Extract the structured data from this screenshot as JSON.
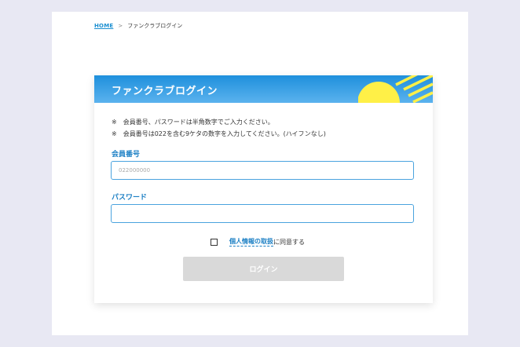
{
  "breadcrumb": {
    "home": "HOME",
    "separator": ">",
    "current": "ファンクラブログイン"
  },
  "card": {
    "title": "ファンクラブログイン"
  },
  "notes": [
    {
      "mark": "※",
      "text": "会員番号、パスワードは半角数字でご入力ください。"
    },
    {
      "mark": "※",
      "text": "会員番号は022を含む9ケタの数字を入力してください。(ハイフンなし)"
    }
  ],
  "member_number": {
    "label": "会員番号",
    "placeholder": "022000000",
    "value": ""
  },
  "password": {
    "label": "パスワード",
    "value": ""
  },
  "agreement": {
    "link": "個人情報の取扱",
    "suffix": "に同意する",
    "checked": false
  },
  "login_button": {
    "label": "ログイン",
    "enabled": false
  },
  "colors": {
    "accent": "#1b7fc4",
    "header_top": "#1e8fdc",
    "header_bottom": "#5bb2ee",
    "sun": "#fff047",
    "button_disabled": "#d9d9d9",
    "background": "#e8e8f3"
  },
  "icons": {
    "sun": "sun-icon"
  }
}
